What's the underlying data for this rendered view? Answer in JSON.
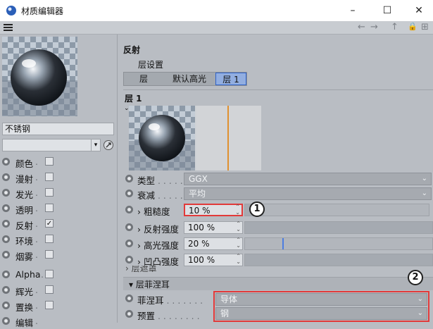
{
  "window": {
    "title": "材质编辑器",
    "controls": [
      "–",
      "☐",
      "✕"
    ]
  },
  "toolbar": {
    "menu_icon": "hamburger-icon",
    "nav_icons": [
      "←",
      "→",
      "↑",
      "🔒",
      "⊞"
    ]
  },
  "material": {
    "name": "不锈钢",
    "select_value": ""
  },
  "channels": [
    {
      "label": "颜色",
      "checked": false
    },
    {
      "label": "漫射",
      "checked": false
    },
    {
      "label": "发光",
      "checked": false
    },
    {
      "label": "透明",
      "checked": false
    },
    {
      "label": "反射",
      "checked": true
    },
    {
      "label": "环境",
      "checked": false
    },
    {
      "label": "烟雾",
      "checked": false
    },
    {
      "label": "Alpha",
      "checked": false
    },
    {
      "label": "辉光",
      "checked": false
    },
    {
      "label": "置换",
      "checked": false
    },
    {
      "label": "编辑",
      "checked": false
    }
  ],
  "reflect": {
    "section_title": "反射",
    "layer_settings_label": "层设置",
    "tabs": [
      "层",
      "默认高光",
      "层 1"
    ],
    "active_tab": 2,
    "layer_title": "层 1",
    "props": {
      "type_label": "类型",
      "type_value": "GGX",
      "falloff_label": "衰减",
      "falloff_value": "平均",
      "roughness_label": "› 粗糙度",
      "roughness_value": "10 %",
      "roughness_fraction": 0.1,
      "reflect_strength_label": "› 反射强度",
      "reflect_strength_value": "100 %",
      "reflect_strength_fraction": 1.0,
      "spec_strength_label": "› 高光强度",
      "spec_strength_value": "20 %",
      "spec_strength_fraction": 0.2,
      "bump_strength_label": "› 凹凸强度",
      "bump_strength_value": "100 %",
      "bump_strength_fraction": 1.0,
      "layer_mask_label": "› 层遮罩"
    },
    "fresnel": {
      "header": "▾ 层菲涅耳",
      "fresnel_label": "菲涅耳",
      "fresnel_value": "导体",
      "preset_label": "预置",
      "preset_value": "钢"
    },
    "annotations": [
      "1",
      "2"
    ]
  },
  "colors": {
    "highlight_border": "#e23a3a",
    "active_tab": "#92aee0",
    "orange_marker": "#e0902e"
  }
}
